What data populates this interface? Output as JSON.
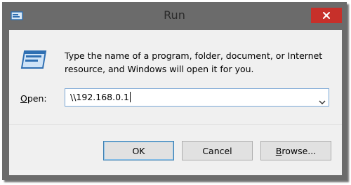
{
  "window": {
    "title": "Run"
  },
  "description": "Type the name of a program, folder, document, or Internet resource, and Windows will open it for you.",
  "open_field": {
    "label_prefix": "O",
    "label_rest": "pen:",
    "value": "\\\\192.168.0.1"
  },
  "buttons": {
    "ok": "OK",
    "cancel": "Cancel",
    "browse_prefix": "B",
    "browse_rest": "rowse..."
  },
  "icons": {
    "app": "run-app-icon",
    "close": "close-icon",
    "run": "run-icon",
    "dropdown": "chevron-down-icon"
  },
  "colors": {
    "frame": "#6b6b6b",
    "close": "#c7302a",
    "client": "#f0f0f0",
    "accent": "#3c7fb1"
  }
}
